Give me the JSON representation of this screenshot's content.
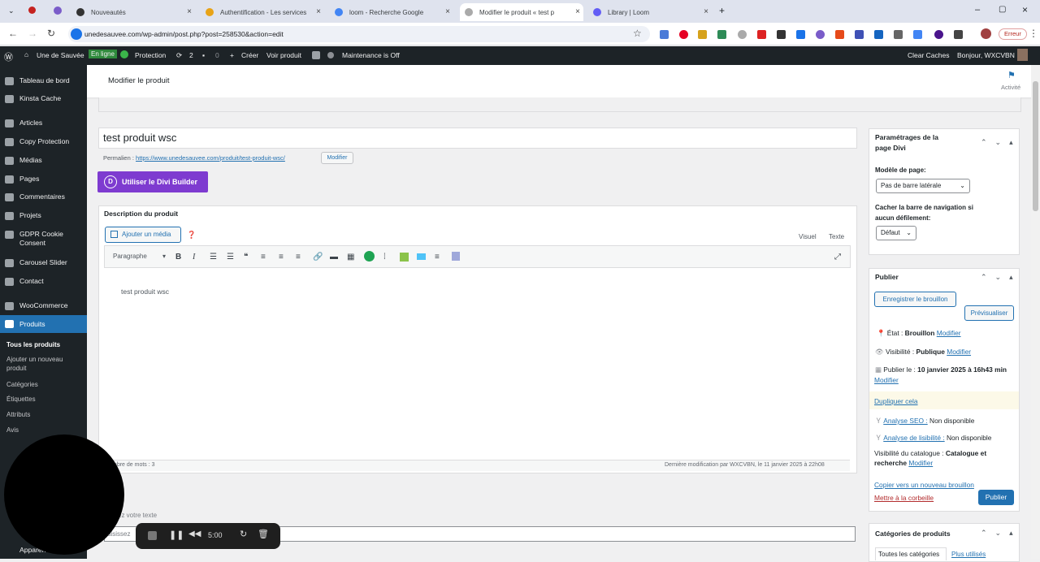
{
  "browser": {
    "tabs": [
      {
        "label": "Nouveautés",
        "color": "#3c4043"
      },
      {
        "label": "Authentification - Les services",
        "color": "#e8a317"
      },
      {
        "label": "loom - Recherche Google",
        "color": "#4285f4"
      },
      {
        "label": "Modifier le produit « test p",
        "color": "#888"
      },
      {
        "label": "Library | Loom",
        "color": "#625df5"
      }
    ],
    "url": "unedesauvee.com/wp-admin/post.php?post=258530&action=edit",
    "error_label": "Erreur"
  },
  "adminbar": {
    "site": "Une de Sauvée",
    "online_badge": "En ligne",
    "protection": "Protection",
    "updates": "2",
    "comments": "0",
    "create": "Créer",
    "view": "Voir produit",
    "maintenance": "Maintenance is Off",
    "clear": "Clear Caches",
    "greeting": "Bonjour, WXCVBN"
  },
  "sidebar": {
    "items": [
      "Tableau de bord",
      "Kinsta Cache",
      "Articles",
      "Copy Protection",
      "Médias",
      "Pages",
      "Commentaires",
      "Projets",
      "GDPR Cookie Consent",
      "Carousel Slider",
      "Contact",
      "WooCommerce",
      "Produits"
    ],
    "sub": [
      "Tous les produits",
      "Ajouter un nouveau produit",
      "Catégories",
      "Étiquettes",
      "Attributs",
      "Avis"
    ],
    "bottom": "Apparen"
  },
  "header": {
    "title": "Modifier le produit",
    "activity": "Activité"
  },
  "editor": {
    "post_title": "test produit wsc",
    "permalink_label": "Permalien :",
    "permalink_url": "https://www.unedesauvee.com/produit/test-produit-wsc/",
    "permalink_modify": "Modifier",
    "divi_button": "Utiliser le Divi Builder",
    "desc_heading": "Description du produit",
    "add_media": "Ajouter un média",
    "tab_visual": "Visuel",
    "tab_text": "Texte",
    "format": "Paragraphe",
    "content": "test produit wsc",
    "word_count": "mbre de mots : 3",
    "last_mod": "Dernière modification par WXCVBN, le 11 janvier 2025 à 22h08",
    "excerpt_hint": "ez votre texte",
    "excerpt_input": "aisissez"
  },
  "divi": {
    "title": "Paramétrages de la page Divi",
    "page_model_label": "Modèle de page:",
    "page_model_value": "Pas de barre latérale",
    "hide_nav_label": "Cacher la barre de navigation si aucun défilement:",
    "hide_nav_value": "Défaut"
  },
  "publish": {
    "title": "Publier",
    "save_draft": "Enregistrer le brouillon",
    "preview": "Prévisualiser",
    "status_label": "État :",
    "status_value": "Brouillon",
    "modify": "Modifier",
    "visibility_label": "Visibilité :",
    "visibility_value": "Publique",
    "publish_on_label": "Publier le :",
    "publish_on_value": "10 janvier 2025 à 16h43 min",
    "duplicate": "Dupliquer cela",
    "seo_label": "Analyse SEO :",
    "seo_value": "Non disponible",
    "read_label": "Analyse de lisibilité :",
    "read_value": "Non disponible",
    "catalog_label": "Visibilité du catalogue :",
    "catalog_value": "Catalogue et recherche",
    "copy_draft": "Copier vers un nouveau brouillon",
    "trash": "Mettre à la corbeille",
    "publish_btn": "Publier"
  },
  "categories": {
    "title": "Catégories de produits",
    "tab_all": "Toutes les catégories",
    "tab_used": "Plus utilisés"
  },
  "recorder": {
    "time": "5:00"
  }
}
